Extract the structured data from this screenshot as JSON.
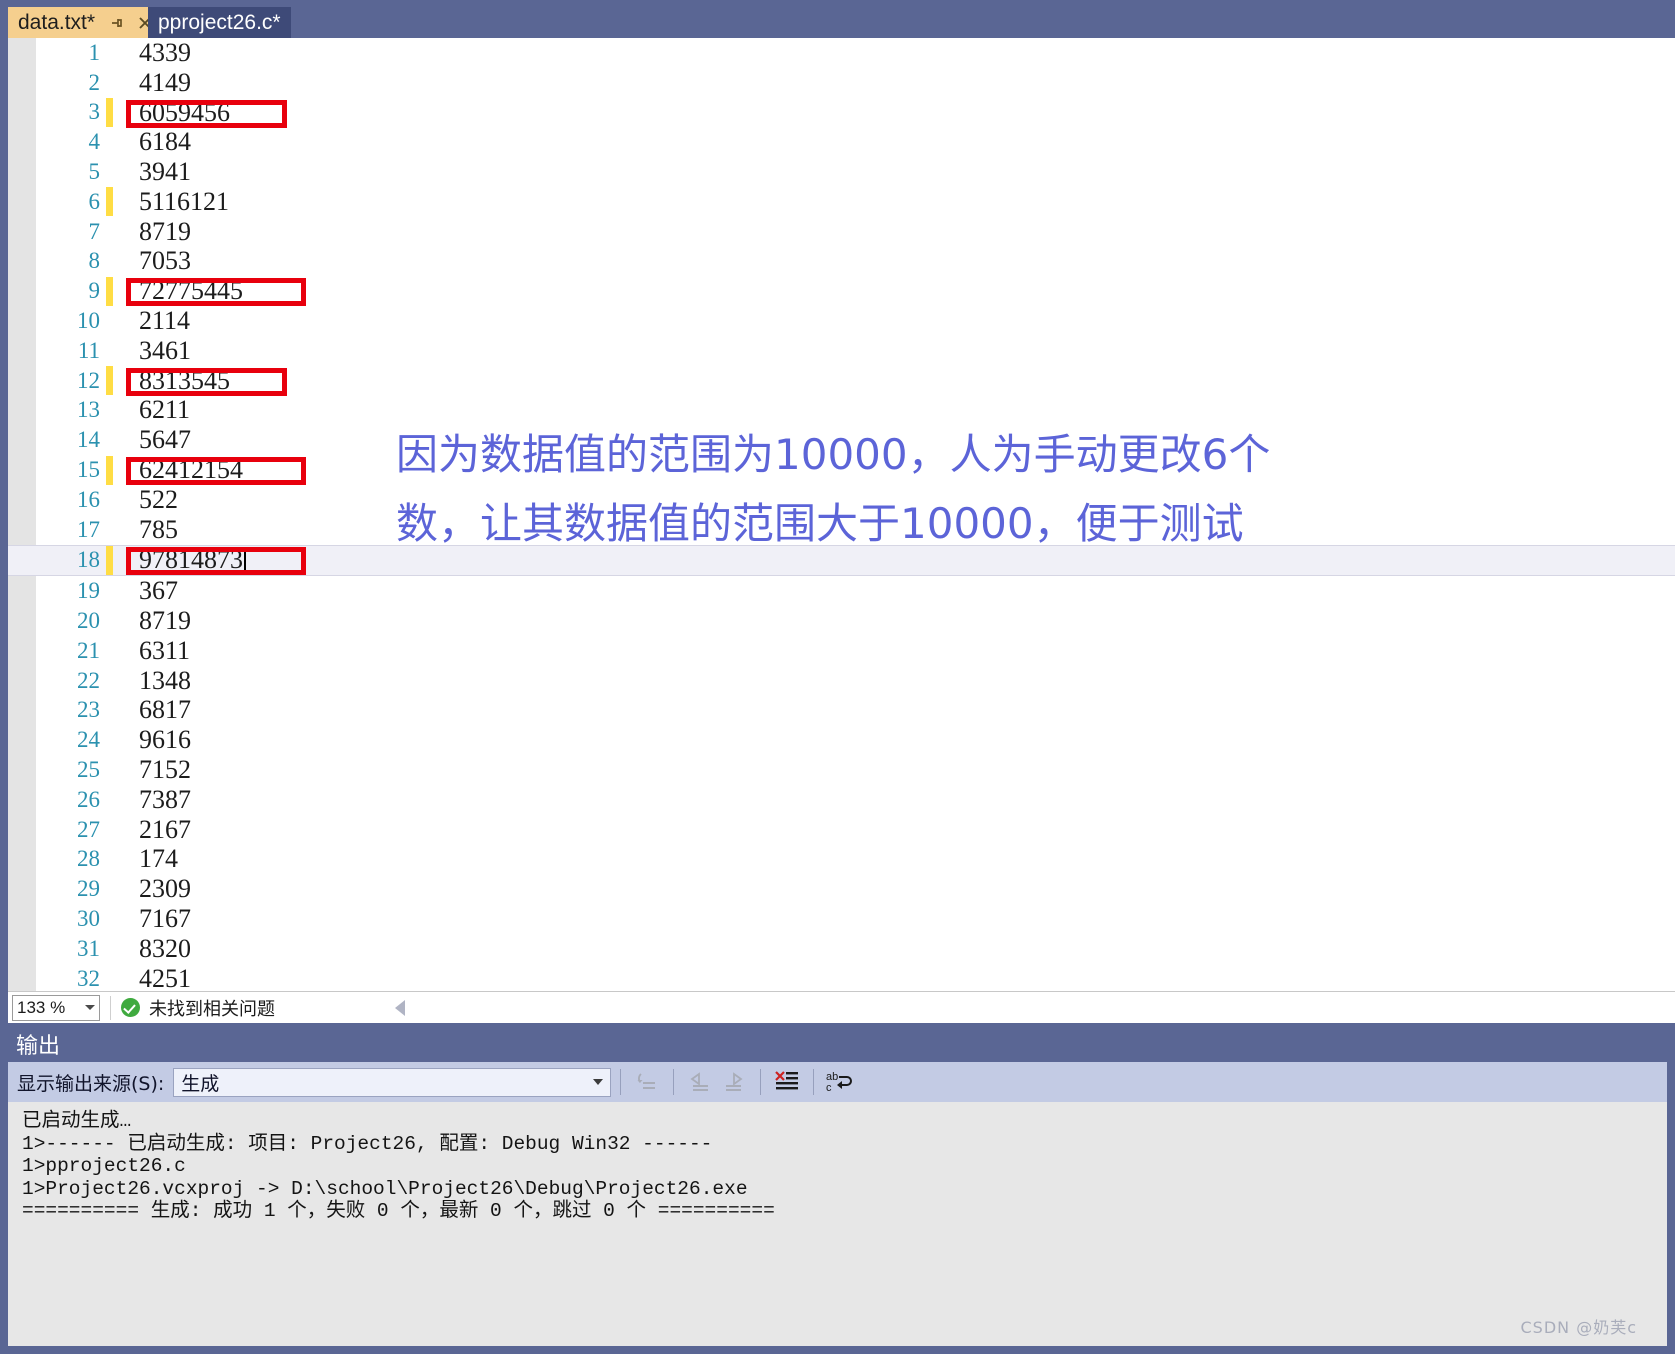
{
  "window": {
    "chrome_color": "#5a6694"
  },
  "tabs": [
    {
      "label": "data.txt*",
      "active": true,
      "pin_icon": "pin-icon",
      "close_icon": "close-icon"
    },
    {
      "label": "pproject26.c*",
      "active": false
    }
  ],
  "editor": {
    "lines": [
      {
        "num": "1",
        "text": "4339",
        "changed": false,
        "boxed": false,
        "current": false
      },
      {
        "num": "2",
        "text": "4149",
        "changed": false,
        "boxed": false,
        "current": false
      },
      {
        "num": "3",
        "text": "6059456",
        "changed": true,
        "boxed": true,
        "current": false
      },
      {
        "num": "4",
        "text": "6184",
        "changed": false,
        "boxed": false,
        "current": false
      },
      {
        "num": "5",
        "text": "3941",
        "changed": false,
        "boxed": false,
        "current": false
      },
      {
        "num": "6",
        "text": "5116121",
        "changed": true,
        "boxed": false,
        "current": false
      },
      {
        "num": "7",
        "text": "8719",
        "changed": false,
        "boxed": false,
        "current": false
      },
      {
        "num": "8",
        "text": "7053",
        "changed": false,
        "boxed": false,
        "current": false
      },
      {
        "num": "9",
        "text": "72775445",
        "changed": true,
        "boxed": true,
        "current": false
      },
      {
        "num": "10",
        "text": "2114",
        "changed": false,
        "boxed": false,
        "current": false
      },
      {
        "num": "11",
        "text": "3461",
        "changed": false,
        "boxed": false,
        "current": false
      },
      {
        "num": "12",
        "text": "8313545",
        "changed": true,
        "boxed": true,
        "current": false
      },
      {
        "num": "13",
        "text": "6211",
        "changed": false,
        "boxed": false,
        "current": false
      },
      {
        "num": "14",
        "text": "5647",
        "changed": false,
        "boxed": false,
        "current": false
      },
      {
        "num": "15",
        "text": "62412154",
        "changed": true,
        "boxed": true,
        "current": false
      },
      {
        "num": "16",
        "text": "522",
        "changed": false,
        "boxed": false,
        "current": false
      },
      {
        "num": "17",
        "text": "785",
        "changed": false,
        "boxed": false,
        "current": false
      },
      {
        "num": "18",
        "text": "97814873",
        "changed": true,
        "boxed": true,
        "current": true
      },
      {
        "num": "19",
        "text": "367",
        "changed": false,
        "boxed": false,
        "current": false
      },
      {
        "num": "20",
        "text": "8719",
        "changed": false,
        "boxed": false,
        "current": false
      },
      {
        "num": "21",
        "text": "6311",
        "changed": false,
        "boxed": false,
        "current": false
      },
      {
        "num": "22",
        "text": "1348",
        "changed": false,
        "boxed": false,
        "current": false
      },
      {
        "num": "23",
        "text": "6817",
        "changed": false,
        "boxed": false,
        "current": false
      },
      {
        "num": "24",
        "text": "9616",
        "changed": false,
        "boxed": false,
        "current": false
      },
      {
        "num": "25",
        "text": "7152",
        "changed": false,
        "boxed": false,
        "current": false
      },
      {
        "num": "26",
        "text": "7387",
        "changed": false,
        "boxed": false,
        "current": false
      },
      {
        "num": "27",
        "text": "2167",
        "changed": false,
        "boxed": false,
        "current": false
      },
      {
        "num": "28",
        "text": "174",
        "changed": false,
        "boxed": false,
        "current": false
      },
      {
        "num": "29",
        "text": "2309",
        "changed": false,
        "boxed": false,
        "current": false
      },
      {
        "num": "30",
        "text": "7167",
        "changed": false,
        "boxed": false,
        "current": false
      },
      {
        "num": "31",
        "text": "8320",
        "changed": false,
        "boxed": false,
        "current": false
      },
      {
        "num": "32",
        "text": "4251",
        "changed": false,
        "boxed": false,
        "current": false
      }
    ]
  },
  "annotation": {
    "text": "因为数据值的范围为10000，人为手动更改6个\n数，让其数据值的范围大于10000，便于测试",
    "color": "#5c64d8",
    "box_color": "#e8000d",
    "change_marker_color": "#ffdd44"
  },
  "status_bar": {
    "zoom_level": "133 %",
    "message": "未找到相关问题",
    "ok_icon": "checkmark-circle-icon",
    "dropdown_icon": "chevron-down-icon",
    "scroll_icon": "scroll-left-arrow-icon"
  },
  "output_panel": {
    "title": "输出",
    "source_label": "显示输出来源(S):",
    "source_value": "生成",
    "toolbar_buttons": [
      {
        "icon": "go-to-source-icon",
        "name": "go-to-source-button"
      },
      {
        "icon": "navigate-back-icon",
        "name": "navigate-back-button"
      },
      {
        "icon": "navigate-forward-icon",
        "name": "navigate-forward-button"
      },
      {
        "icon": "clear-all-icon",
        "name": "clear-all-button"
      },
      {
        "icon": "toggle-word-wrap-icon",
        "name": "toggle-word-wrap-button"
      }
    ],
    "log": "已启动生成…\n1>------ 已启动生成: 项目: Project26, 配置: Debug Win32 ------\n1>pproject26.c\n1>Project26.vcxproj -> D:\\school\\Project26\\Debug\\Project26.exe\n========== 生成: 成功 1 个，失败 0 个，最新 0 个，跳过 0 个 =========="
  },
  "watermark": {
    "text": "CSDN @奶芙c"
  }
}
